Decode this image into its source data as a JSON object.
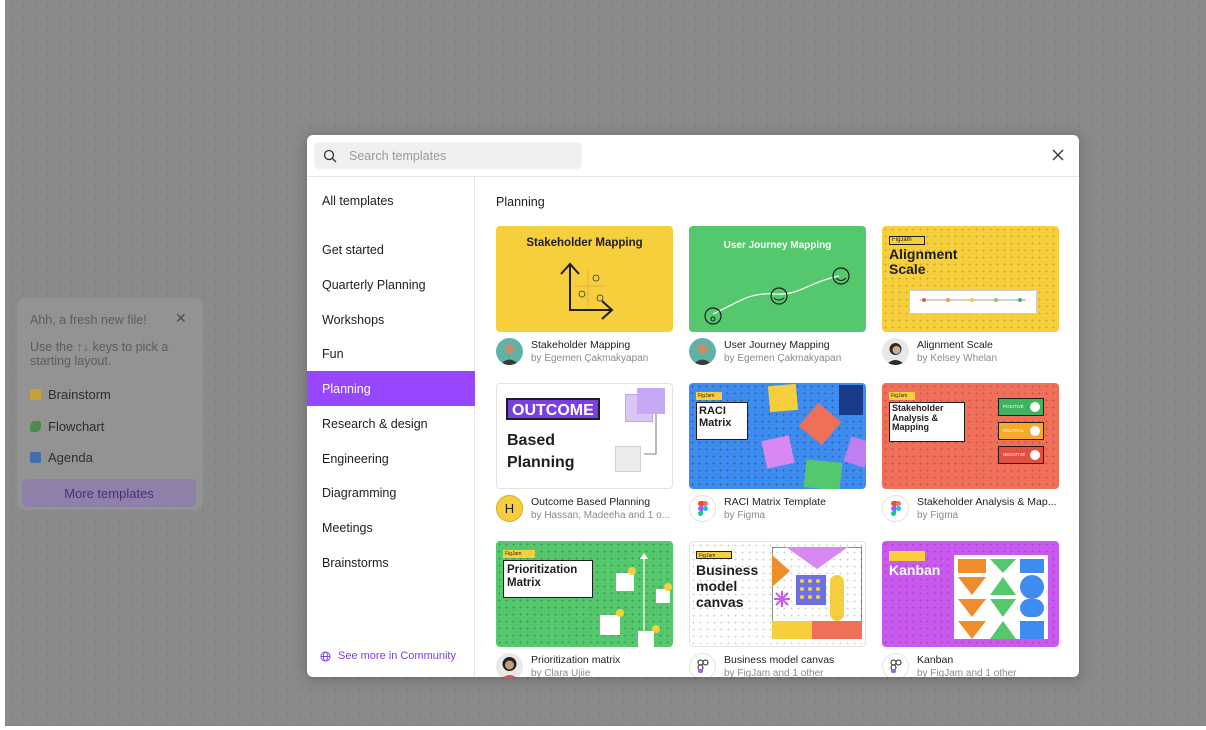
{
  "onboarding": {
    "greeting": "Ahh, a fresh new file!",
    "hint": "Use the ↑↓ keys to pick a starting layout.",
    "items": [
      {
        "label": "Brainstorm",
        "color": "#c9a13a"
      },
      {
        "label": "Flowchart",
        "color": "#4d8a4c"
      },
      {
        "label": "Agenda",
        "color": "#3f6fae"
      }
    ],
    "more_label": "More templates"
  },
  "search": {
    "placeholder": "Search templates"
  },
  "sidebar": {
    "all_label": "All templates",
    "items": [
      {
        "label": "Get started"
      },
      {
        "label": "Quarterly Planning"
      },
      {
        "label": "Workshops"
      },
      {
        "label": "Fun"
      },
      {
        "label": "Planning"
      },
      {
        "label": "Research & design"
      },
      {
        "label": "Engineering"
      },
      {
        "label": "Diagramming"
      },
      {
        "label": "Meetings"
      },
      {
        "label": "Brainstorms"
      }
    ],
    "active_index": 4,
    "community_label": "See more in Community"
  },
  "section_title": "Planning",
  "templates": [
    {
      "title": "Stakeholder Mapping",
      "author": "by Egemen Çakmakyapan",
      "thumb_title": "Stakeholder Mapping",
      "bg": "#f7cf3c"
    },
    {
      "title": "User Journey Mapping",
      "author": "by Egemen Çakmakyapan",
      "thumb_title": "User Journey Mapping",
      "bg": "#55c76d"
    },
    {
      "title": "Alignment Scale",
      "author": "by Kelsey Whelan",
      "thumb_title": "Alignment Scale",
      "badge": "FigJam",
      "bg": "#f7cf3c"
    },
    {
      "title": "Outcome Based Planning",
      "author": "by Hassan, Madeeha and 1 o...",
      "thumb_badge": "OUTCOME",
      "thumb_title": "Based Planning",
      "avatar_letter": "H",
      "bg": "#ffffff"
    },
    {
      "title": "RACI Matrix Template",
      "author": "by Figma",
      "thumb_title": "RACI Matrix",
      "badge": "FigJam",
      "bg": "#3f8cf0"
    },
    {
      "title": "Stakeholder Analysis & Map...",
      "author": "by Figma",
      "thumb_title": "Stakeholder Analysis & Mapping",
      "badge": "FigJam",
      "bg": "#ef6f59"
    },
    {
      "title": "Prioritization matrix",
      "author": "by Clara Ujiie",
      "thumb_title": "Prioritization Matrix",
      "badge": "FigJam",
      "bg": "#55c76d"
    },
    {
      "title": "Business model canvas",
      "author": "by FigJam and 1 other",
      "thumb_title": "Business model canvas",
      "badge": "FigJam",
      "bg": "#ffffff"
    },
    {
      "title": "Kanban",
      "author": "by FigJam and 1 other",
      "thumb_title": "Kanban",
      "bg": "#c959ef"
    }
  ],
  "pills": [
    "POSITIVE",
    "NEUTRAL",
    "NEGATIVE"
  ],
  "colors": {
    "accent": "#9747ff",
    "community": "#7b3fe0"
  }
}
